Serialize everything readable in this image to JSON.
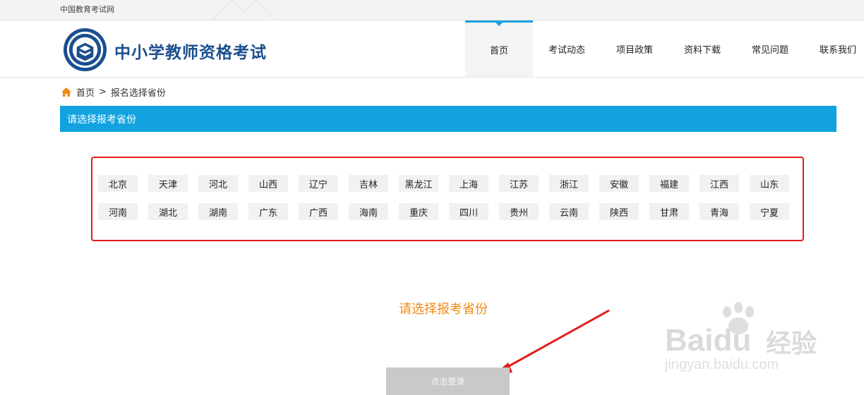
{
  "topbar": {
    "site_link": "中国教育考试网"
  },
  "header": {
    "logo_title": "中小学教师资格考试",
    "nav": [
      {
        "label": "首页",
        "active": true
      },
      {
        "label": "考试动态",
        "active": false
      },
      {
        "label": "项目政策",
        "active": false
      },
      {
        "label": "资料下载",
        "active": false
      },
      {
        "label": "常见问题",
        "active": false
      },
      {
        "label": "联系我们",
        "active": false
      }
    ]
  },
  "breadcrumb": {
    "home": "首页",
    "separator": ">",
    "current": "报名选择省份"
  },
  "section": {
    "title": "请选择报考省份"
  },
  "provinces": {
    "row1": [
      "北京",
      "天津",
      "河北",
      "山西",
      "辽宁",
      "吉林",
      "黑龙江",
      "上海",
      "江苏",
      "浙江",
      "安徽",
      "福建",
      "江西",
      "山东"
    ],
    "row2": [
      "河南",
      "湖北",
      "湖南",
      "广东",
      "广西",
      "海南",
      "重庆",
      "四川",
      "贵州",
      "云南",
      "陕西",
      "甘肃",
      "青海",
      "宁夏"
    ]
  },
  "prompt": "请选择报考省份",
  "login_button": "点击登录",
  "watermark": {
    "brand": "Bai",
    "brand_suffix": "du",
    "brand_cn": "经验",
    "url": "jingyan.baidu.com"
  },
  "colors": {
    "accent": "#12a2df",
    "highlight_border": "#e21b1b",
    "prompt": "#f08a16",
    "title": "#1b4f8f"
  }
}
